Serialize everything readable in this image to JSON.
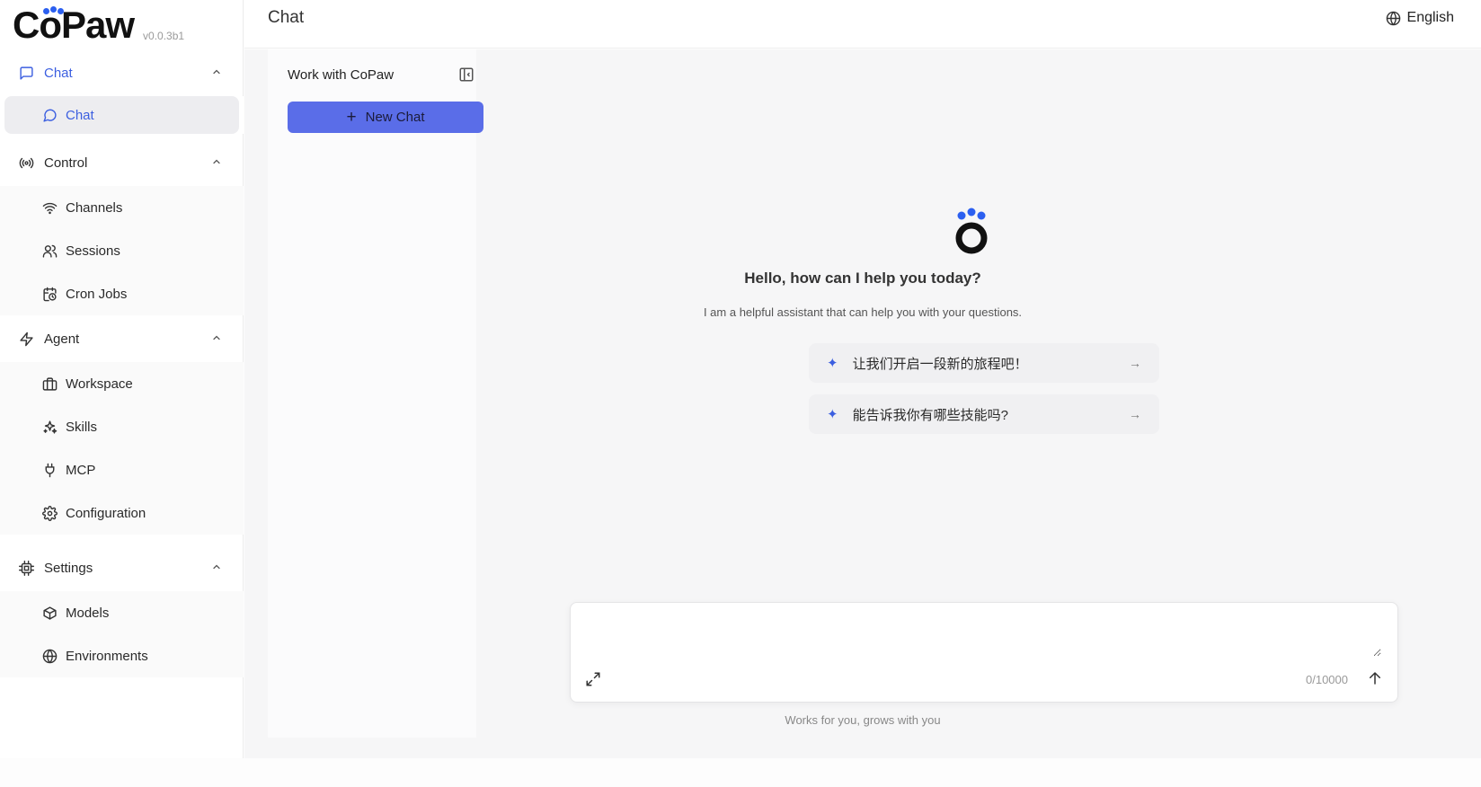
{
  "app": {
    "logo_text": "CoPaw",
    "version": "v0.0.3b1",
    "brand_color": "#3c5fe0"
  },
  "sidebar": {
    "groups": [
      {
        "label": "Chat",
        "icon": "message-square-icon",
        "expanded": true,
        "items": [
          {
            "label": "Chat",
            "icon": "message-circle-icon",
            "active": true
          }
        ]
      },
      {
        "label": "Control",
        "icon": "radio-icon",
        "expanded": true,
        "items": [
          {
            "label": "Channels",
            "icon": "wifi-icon"
          },
          {
            "label": "Sessions",
            "icon": "users-icon"
          },
          {
            "label": "Cron Jobs",
            "icon": "calendar-clock-icon"
          }
        ]
      },
      {
        "label": "Agent",
        "icon": "zap-icon",
        "expanded": true,
        "items": [
          {
            "label": "Workspace",
            "icon": "briefcase-icon"
          },
          {
            "label": "Skills",
            "icon": "sparkles-icon"
          },
          {
            "label": "MCP",
            "icon": "plug-icon"
          },
          {
            "label": "Configuration",
            "icon": "gear-icon"
          }
        ]
      },
      {
        "label": "Settings",
        "icon": "cpu-icon",
        "expanded": true,
        "items": [
          {
            "label": "Models",
            "icon": "box-icon"
          },
          {
            "label": "Environments",
            "icon": "globe-icon"
          }
        ]
      }
    ]
  },
  "header": {
    "title": "Chat",
    "language": "English"
  },
  "chat_list": {
    "title": "Work with CoPaw",
    "new_chat_label": "New Chat"
  },
  "welcome": {
    "greeting": "Hello, how can I help you today?",
    "subtitle": "I am a helpful assistant that can help you with your questions.",
    "prompts": [
      "让我们开启一段新的旅程吧！",
      "能告诉我你有哪些技能吗?"
    ]
  },
  "composer": {
    "placeholder": "",
    "counter": "0/10000",
    "tagline": "Works for you, grows with you"
  }
}
